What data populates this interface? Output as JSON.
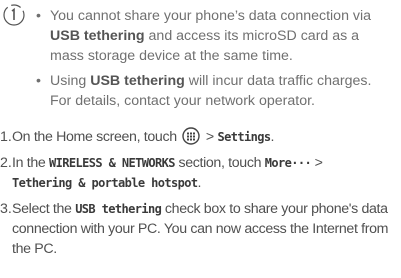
{
  "note": {
    "icon": "note-icon",
    "bullet_char": "•",
    "bullets": [
      {
        "p1": "You cannot share your phone’s data connection via ",
        "b1": "USB tethering",
        "p2": " and access its microSD card as a mass storage device at the same time."
      },
      {
        "p1": "Using ",
        "b1": "USB tethering",
        "p2": " will incur data traffic charges. For details, contact your network operator."
      }
    ]
  },
  "steps": [
    {
      "num": "1.",
      "t1": "On the Home screen, touch ",
      "icon": "menu-dots-icon",
      "t2": " > ",
      "m1": "Settings",
      "t3": "."
    },
    {
      "num": "2.",
      "t1": "In the ",
      "m1": "WIRELESS & NETWORKS",
      "t2": " section, touch ",
      "m2": "More···",
      "t3": " > ",
      "m3": "Tethering & portable hotspot",
      "t4": "."
    },
    {
      "num": "3.",
      "t1": "Select the ",
      "m1": "USB tethering",
      "t2": " check box to share your phone's data connection with your PC. You can now access the Internet from the PC."
    }
  ]
}
